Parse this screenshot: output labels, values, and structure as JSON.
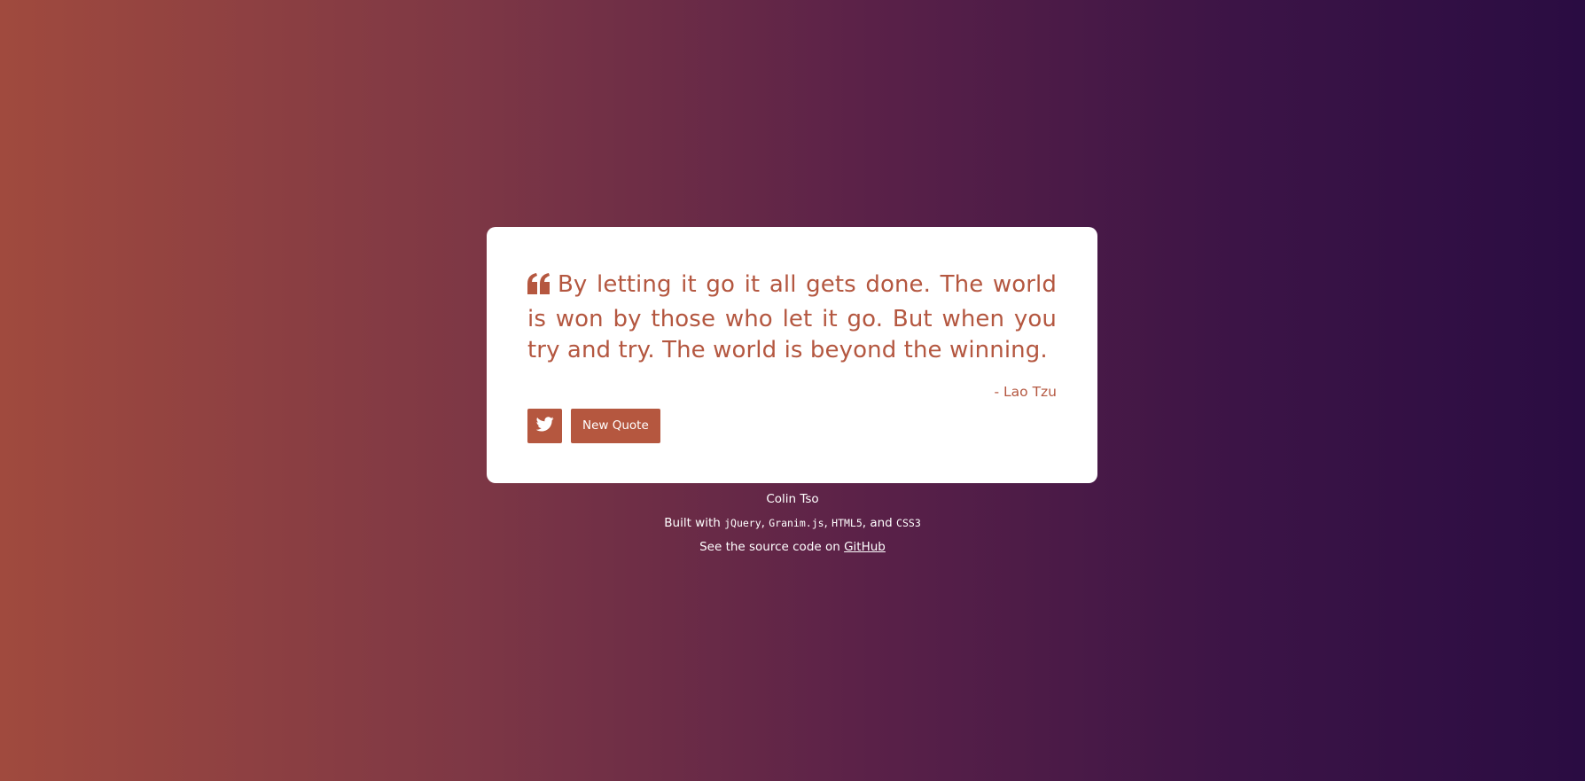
{
  "quote": {
    "icon": "quote-left-icon",
    "text": "By letting it go it all gets done. The world is won by those who let it go. But when you try and try. The world is beyond the winning.",
    "author": "- Lao Tzu"
  },
  "actions": {
    "tweet_icon": "twitter-icon",
    "new_quote_label": "New Quote"
  },
  "footer": {
    "author": "Colin Tso",
    "built_prefix": "Built with ",
    "tech1": "jQuery",
    "sep1": ", ",
    "tech2": "Granim.js",
    "sep2": ", ",
    "tech3": "HTML5",
    "sep3": ", and ",
    "tech4": "CSS3",
    "source_prefix": "See the source code on ",
    "source_link": "GitHub"
  },
  "colors": {
    "accent": "#b5573f",
    "gradient_start": "#a04a3e",
    "gradient_end": "#2a0c42"
  }
}
